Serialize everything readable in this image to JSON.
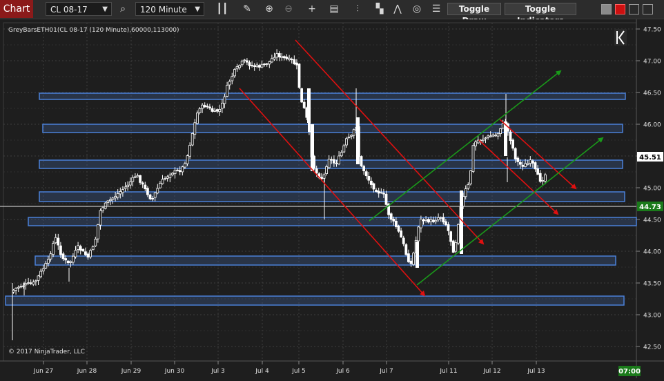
{
  "toolbar": {
    "chart_tab": "Chart",
    "instrument": "CL 08-17",
    "interval": "120 Minute",
    "toggle_draw": "Toggle Draw",
    "toggle_indicators": "Toggle Indicators"
  },
  "chart": {
    "indicator_label": "GreyBarsETH01(CL 08-17 (120 Minute),60000,113000)",
    "copyright": "© 2017 NinjaTrader, LLC",
    "y_ticks": [
      "47.50",
      "47.00",
      "46.50",
      "46.00",
      "45.50",
      "45.00",
      "44.50",
      "44.00",
      "43.50",
      "43.00",
      "42.50"
    ],
    "x_ticks": [
      "Jun 27",
      "Jun 28",
      "Jun 29",
      "Jun 30",
      "Jul 3",
      "Jul 4",
      "Jul 5",
      "Jul 6",
      "Jul 7",
      "Jul 11",
      "Jul 12",
      "Jul 13"
    ],
    "price_markers": [
      {
        "value": "45.51",
        "fg": "#000000",
        "bg": "#ffffff"
      },
      {
        "value": "44.73",
        "fg": "#ffffff",
        "bg": "#1a7a1a"
      }
    ],
    "time_marker": "07:00",
    "colors": {
      "bg": "#1e1e1e",
      "zone": "#4a80d8",
      "down": "#e01010",
      "up": "#1a9a1a",
      "candle": "#ffffff"
    }
  }
}
